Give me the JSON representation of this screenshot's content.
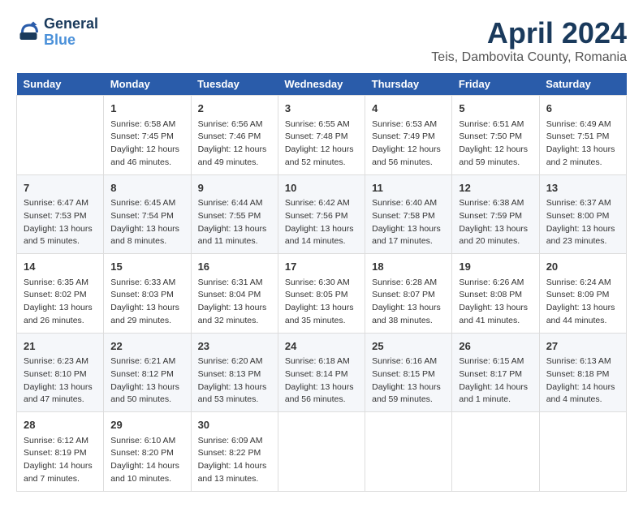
{
  "header": {
    "logo_line1": "General",
    "logo_line2": "Blue",
    "main_title": "April 2024",
    "subtitle": "Teis, Dambovita County, Romania"
  },
  "calendar": {
    "weekdays": [
      "Sunday",
      "Monday",
      "Tuesday",
      "Wednesday",
      "Thursday",
      "Friday",
      "Saturday"
    ],
    "weeks": [
      [
        {
          "day": "",
          "info": ""
        },
        {
          "day": "1",
          "info": "Sunrise: 6:58 AM\nSunset: 7:45 PM\nDaylight: 12 hours\nand 46 minutes."
        },
        {
          "day": "2",
          "info": "Sunrise: 6:56 AM\nSunset: 7:46 PM\nDaylight: 12 hours\nand 49 minutes."
        },
        {
          "day": "3",
          "info": "Sunrise: 6:55 AM\nSunset: 7:48 PM\nDaylight: 12 hours\nand 52 minutes."
        },
        {
          "day": "4",
          "info": "Sunrise: 6:53 AM\nSunset: 7:49 PM\nDaylight: 12 hours\nand 56 minutes."
        },
        {
          "day": "5",
          "info": "Sunrise: 6:51 AM\nSunset: 7:50 PM\nDaylight: 12 hours\nand 59 minutes."
        },
        {
          "day": "6",
          "info": "Sunrise: 6:49 AM\nSunset: 7:51 PM\nDaylight: 13 hours\nand 2 minutes."
        }
      ],
      [
        {
          "day": "7",
          "info": "Sunrise: 6:47 AM\nSunset: 7:53 PM\nDaylight: 13 hours\nand 5 minutes."
        },
        {
          "day": "8",
          "info": "Sunrise: 6:45 AM\nSunset: 7:54 PM\nDaylight: 13 hours\nand 8 minutes."
        },
        {
          "day": "9",
          "info": "Sunrise: 6:44 AM\nSunset: 7:55 PM\nDaylight: 13 hours\nand 11 minutes."
        },
        {
          "day": "10",
          "info": "Sunrise: 6:42 AM\nSunset: 7:56 PM\nDaylight: 13 hours\nand 14 minutes."
        },
        {
          "day": "11",
          "info": "Sunrise: 6:40 AM\nSunset: 7:58 PM\nDaylight: 13 hours\nand 17 minutes."
        },
        {
          "day": "12",
          "info": "Sunrise: 6:38 AM\nSunset: 7:59 PM\nDaylight: 13 hours\nand 20 minutes."
        },
        {
          "day": "13",
          "info": "Sunrise: 6:37 AM\nSunset: 8:00 PM\nDaylight: 13 hours\nand 23 minutes."
        }
      ],
      [
        {
          "day": "14",
          "info": "Sunrise: 6:35 AM\nSunset: 8:02 PM\nDaylight: 13 hours\nand 26 minutes."
        },
        {
          "day": "15",
          "info": "Sunrise: 6:33 AM\nSunset: 8:03 PM\nDaylight: 13 hours\nand 29 minutes."
        },
        {
          "day": "16",
          "info": "Sunrise: 6:31 AM\nSunset: 8:04 PM\nDaylight: 13 hours\nand 32 minutes."
        },
        {
          "day": "17",
          "info": "Sunrise: 6:30 AM\nSunset: 8:05 PM\nDaylight: 13 hours\nand 35 minutes."
        },
        {
          "day": "18",
          "info": "Sunrise: 6:28 AM\nSunset: 8:07 PM\nDaylight: 13 hours\nand 38 minutes."
        },
        {
          "day": "19",
          "info": "Sunrise: 6:26 AM\nSunset: 8:08 PM\nDaylight: 13 hours\nand 41 minutes."
        },
        {
          "day": "20",
          "info": "Sunrise: 6:24 AM\nSunset: 8:09 PM\nDaylight: 13 hours\nand 44 minutes."
        }
      ],
      [
        {
          "day": "21",
          "info": "Sunrise: 6:23 AM\nSunset: 8:10 PM\nDaylight: 13 hours\nand 47 minutes."
        },
        {
          "day": "22",
          "info": "Sunrise: 6:21 AM\nSunset: 8:12 PM\nDaylight: 13 hours\nand 50 minutes."
        },
        {
          "day": "23",
          "info": "Sunrise: 6:20 AM\nSunset: 8:13 PM\nDaylight: 13 hours\nand 53 minutes."
        },
        {
          "day": "24",
          "info": "Sunrise: 6:18 AM\nSunset: 8:14 PM\nDaylight: 13 hours\nand 56 minutes."
        },
        {
          "day": "25",
          "info": "Sunrise: 6:16 AM\nSunset: 8:15 PM\nDaylight: 13 hours\nand 59 minutes."
        },
        {
          "day": "26",
          "info": "Sunrise: 6:15 AM\nSunset: 8:17 PM\nDaylight: 14 hours\nand 1 minute."
        },
        {
          "day": "27",
          "info": "Sunrise: 6:13 AM\nSunset: 8:18 PM\nDaylight: 14 hours\nand 4 minutes."
        }
      ],
      [
        {
          "day": "28",
          "info": "Sunrise: 6:12 AM\nSunset: 8:19 PM\nDaylight: 14 hours\nand 7 minutes."
        },
        {
          "day": "29",
          "info": "Sunrise: 6:10 AM\nSunset: 8:20 PM\nDaylight: 14 hours\nand 10 minutes."
        },
        {
          "day": "30",
          "info": "Sunrise: 6:09 AM\nSunset: 8:22 PM\nDaylight: 14 hours\nand 13 minutes."
        },
        {
          "day": "",
          "info": ""
        },
        {
          "day": "",
          "info": ""
        },
        {
          "day": "",
          "info": ""
        },
        {
          "day": "",
          "info": ""
        }
      ]
    ]
  }
}
